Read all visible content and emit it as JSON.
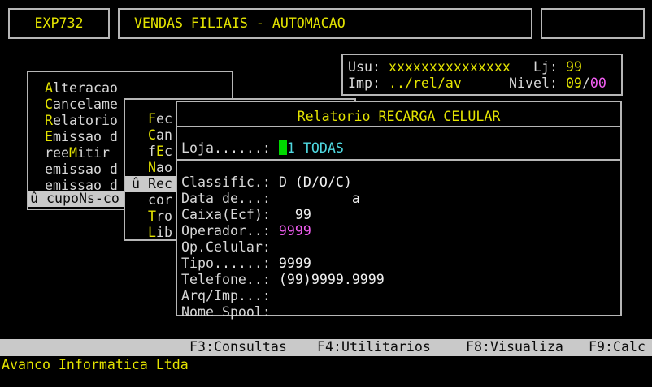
{
  "palette": {
    "background": "#000000",
    "border_gray": "#b6b6b6",
    "text_white": "#d8d8d8",
    "hotkey_yellow": "#e4e400",
    "value_magenta": "#f25ef2",
    "value_cyan": "#4fd8e0",
    "cursor_green": "#00d800",
    "highlight_bg": "#c9c9c9"
  },
  "header": {
    "program_code": "EXP732",
    "title": "VENDAS FILIAIS - AUTOMACAO"
  },
  "session": {
    "usu_label": "Usu: ",
    "usu_value": "xxxxxxxxxxxxxxx",
    "lj_label": "Lj: ",
    "lj_value": "99",
    "imp_label": "Imp: ",
    "imp_value": "../rel/av",
    "nivel_label": "Nivel: ",
    "nivel_value": "09",
    "nivel_sep": "/",
    "nivel_sub": "00"
  },
  "menu": {
    "items": [
      {
        "pre": "",
        "hot": "A",
        "post": "lteracao"
      },
      {
        "pre": "",
        "hot": "C",
        "post": "ancelame"
      },
      {
        "pre": "",
        "hot": "R",
        "post": "elatorio"
      },
      {
        "pre": "",
        "hot": "E",
        "post": "missao d"
      },
      {
        "pre": "ree",
        "hot": "M",
        "post": "itir"
      },
      {
        "pre": "emissao d",
        "hot": "",
        "post": ""
      },
      {
        "pre": "emissao d",
        "hot": "",
        "post": ""
      }
    ],
    "selected": "û cupoNs-co"
  },
  "submenu": {
    "items": [
      {
        "pre": "",
        "hot": "F",
        "post": "ec"
      },
      {
        "pre": "",
        "hot": "C",
        "post": "an"
      },
      {
        "pre": "f",
        "hot": "E",
        "post": "c"
      },
      {
        "pre": "",
        "hot": "N",
        "post": "ao"
      },
      {
        "pre": "cor",
        "hot": "",
        "post": ""
      },
      {
        "pre": "",
        "hot": "T",
        "post": "ro"
      },
      {
        "pre": "",
        "hot": "L",
        "post": "ib"
      }
    ],
    "selected": "û Rec"
  },
  "dialog": {
    "title": "Relatorio RECARGA CELULAR",
    "loja_label": "Loja......:",
    "loja_value": "1 TODAS",
    "fields": [
      {
        "label": "Classific.:",
        "value": "D (D/O/C)"
      },
      {
        "label": "Data de...:",
        "value": "         a"
      },
      {
        "label": "Caixa(Ecf):",
        "value": "  99"
      },
      {
        "label": "Operador..:",
        "value": "9999"
      },
      {
        "label": "Op.Celular:",
        "value": ""
      },
      {
        "label": "Tipo......:",
        "value": "9999"
      },
      {
        "label": "Telefone..:",
        "value": "(99)9999.9999"
      },
      {
        "label": "Arq/Imp...:",
        "value": ""
      },
      {
        "label": "Nome Spool:",
        "value": ""
      }
    ]
  },
  "statusbar": {
    "keys": [
      {
        "label": "F3:Consultas"
      },
      {
        "label": "F4:Utilitarios"
      },
      {
        "label": "F8:Visualiza"
      },
      {
        "label": "F9:Calc"
      }
    ]
  },
  "footer": {
    "company": "Avanco Informatica Ltda"
  }
}
